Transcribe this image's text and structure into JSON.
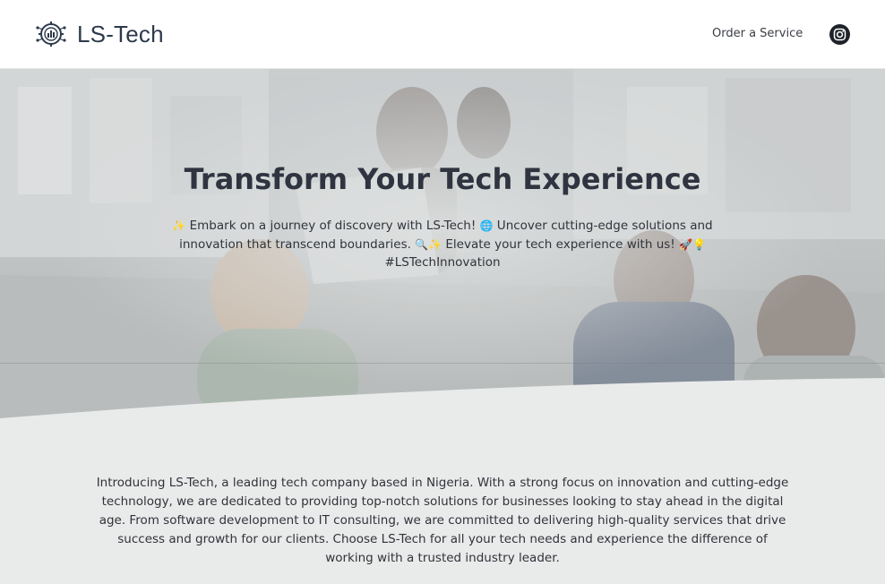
{
  "brand": {
    "name": "LS-Tech",
    "logo_icon": "circuit-gear-chart-icon"
  },
  "nav": {
    "order_label": "Order a Service",
    "social_icon": "instagram-icon"
  },
  "hero": {
    "title": "Transform Your Tech Experience",
    "line1_emoji": "✨",
    "line1_text": " Embark on a journey of discovery with LS-Tech! ",
    "globe_emoji": "🌐",
    "line2_text": " Uncover cutting-edge solutions and innovation that transcend boundaries. ",
    "search_emoji": "🔍",
    "sparkle_emoji": "✨",
    "line3_text": " Elevate your tech experience with us! ",
    "rocket_emoji": "🚀",
    "bulb_emoji": "💡",
    "hashtag": " #LSTechInnovation"
  },
  "about": {
    "text": "Introducing LS-Tech, a leading tech company based in Nigeria. With a strong focus on innovation and cutting-edge technology, we are dedicated to providing top-notch solutions for businesses looking to stay ahead in the digital age. From software development to IT consulting, we are committed to delivering high-quality services that drive success and growth for our clients. Choose LS-Tech for all your tech needs and experience the difference of working with a trusted industry leader."
  },
  "colors": {
    "header_bg": "#ffffff",
    "page_bg": "#e9eaea",
    "title": "#2f3440",
    "text": "#30333a"
  }
}
